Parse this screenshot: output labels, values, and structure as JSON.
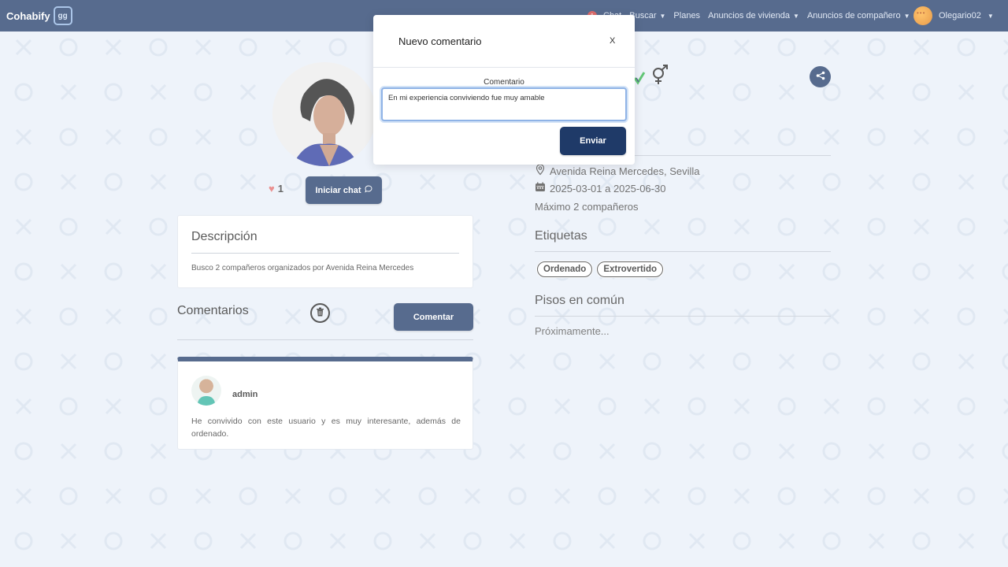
{
  "navbar": {
    "brand": "Cohabify",
    "brand_logo": "gg",
    "links": [
      {
        "label": "Chat",
        "badge": "1"
      },
      {
        "label": "Buscar",
        "caret": true
      },
      {
        "label": "Planes",
        "caret": false
      },
      {
        "label": "Anuncios de vivienda",
        "caret": true
      },
      {
        "label": "Anuncios de compañero",
        "caret": true
      }
    ],
    "user": {
      "name": "Olegario02"
    }
  },
  "profile": {
    "likes": "1",
    "chat_button": "Iniciar chat",
    "description": {
      "title": "Descripción",
      "text": "Busco 2 compañeros organizados por Avenida Reina Mercedes"
    },
    "comments": {
      "title": "Comentarios",
      "add_button": "Comentar",
      "items": [
        {
          "user": "admin",
          "text": "He convivido con este usuario y es muy interesante, además de ordenado."
        }
      ]
    }
  },
  "details": {
    "address": "Avenida Reina Mercedes, Sevilla",
    "dates": "2025-03-01 a 2025-06-30",
    "max": "Máximo 2 compañeros",
    "tags_title": "Etiquetas",
    "tags": [
      "Ordenado",
      "Extrovertido"
    ],
    "common_title": "Pisos en común",
    "common_text": "Próximamente..."
  },
  "modal": {
    "title": "Nuevo comentario",
    "close": "X",
    "field_label": "Comentario",
    "field_value": "En mi experiencia conviviendo fue muy amable",
    "submit": "Enviar"
  },
  "colors": {
    "primary": "#1f3a68",
    "background": "#e9eff8",
    "heart": "#e36b6b"
  }
}
